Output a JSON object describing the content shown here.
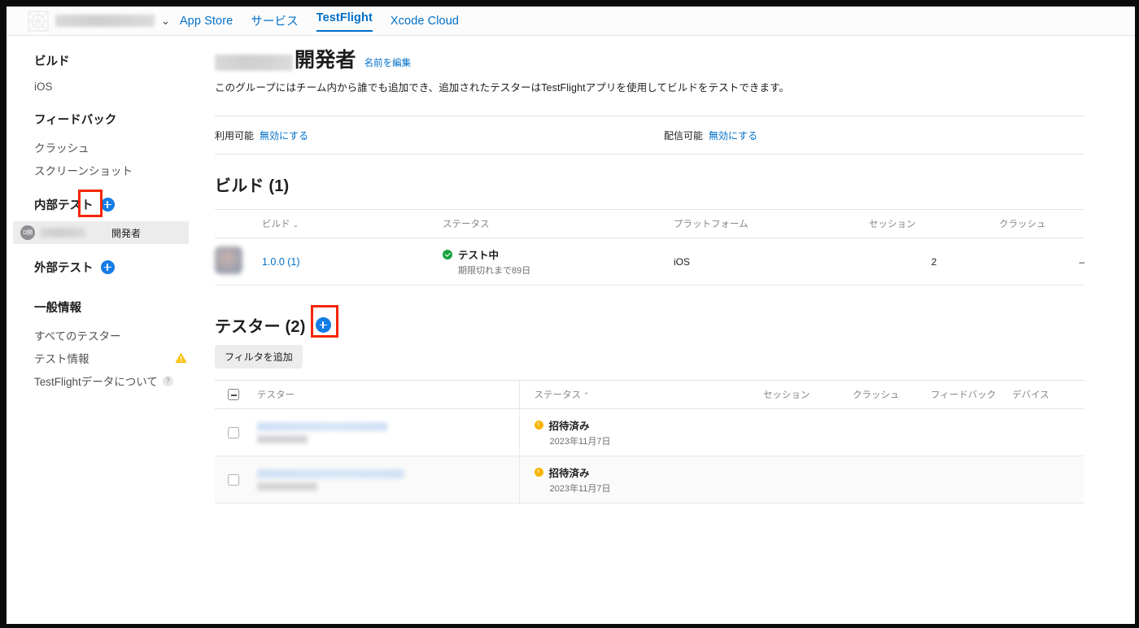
{
  "topnav": {
    "app_name_redacted": true,
    "chevron": "⌄",
    "links": [
      {
        "label": "App Store",
        "active": false
      },
      {
        "label": "サービス",
        "active": false
      },
      {
        "label": "TestFlight",
        "active": true
      },
      {
        "label": "Xcode Cloud",
        "active": false
      }
    ]
  },
  "sidebar": {
    "builds": {
      "title": "ビルド",
      "items": [
        {
          "label": "iOS"
        }
      ]
    },
    "feedback": {
      "title": "フィードバック",
      "items": [
        {
          "label": "クラッシュ"
        },
        {
          "label": "スクリーンショット"
        }
      ]
    },
    "internal": {
      "title": "内部テスト",
      "add_label": "+",
      "group": {
        "avatar_initials": "D開",
        "role_label": "開発者"
      }
    },
    "external": {
      "title": "外部テスト",
      "add_label": "+"
    },
    "general": {
      "title": "一般情報",
      "items": [
        {
          "label": "すべてのテスター",
          "badge": ""
        },
        {
          "label": "テスト情報",
          "badge": "warning"
        },
        {
          "label": "TestFlightデータについて",
          "badge": "help",
          "help_glyph": "?"
        }
      ]
    }
  },
  "main": {
    "group_title": "開発者",
    "edit_name_link": "名前を編集",
    "description": "このグループにはチーム内から誰でも追加でき、追加されたテスターはTestFlightアプリを使用してビルドをテストできます。",
    "availability": {
      "left_label": "利用可能",
      "left_action": "無効にする",
      "right_label": "配信可能",
      "right_action": "無効にする"
    },
    "builds": {
      "title": "ビルド (1)",
      "columns": [
        "ビルド",
        "ステータス",
        "プラットフォーム",
        "セッション",
        "クラッシュ"
      ],
      "sort_column_index": 0,
      "sort_caret": "⌄",
      "rows": [
        {
          "version": "1.0.0 (1)",
          "status": "テスト中",
          "status_sub": "期限切れまで89日",
          "platform": "iOS",
          "sessions": "2",
          "crashes": "–"
        }
      ]
    },
    "testers": {
      "title": "テスター (2)",
      "add_label": "+",
      "filter_button": "フィルタを追加",
      "columns": [
        "テスター",
        "ステータス",
        "セッション",
        "クラッシュ",
        "フィードバック",
        "デバイス"
      ],
      "status_sort_caret": "⌃",
      "rows": [
        {
          "name_redacted": true,
          "status": "招待済み",
          "status_date": "2023年11月7日",
          "sessions": "",
          "crashes": "",
          "feedback": "",
          "device": ""
        },
        {
          "name_redacted": true,
          "status": "招待済み",
          "status_date": "2023年11月7日",
          "sessions": "",
          "crashes": "",
          "feedback": "",
          "device": ""
        }
      ]
    }
  },
  "annotations": {
    "highlight_color": "#f52600",
    "boxes": [
      {
        "name": "internal-test-add-highlight"
      },
      {
        "name": "testers-add-highlight"
      }
    ]
  }
}
